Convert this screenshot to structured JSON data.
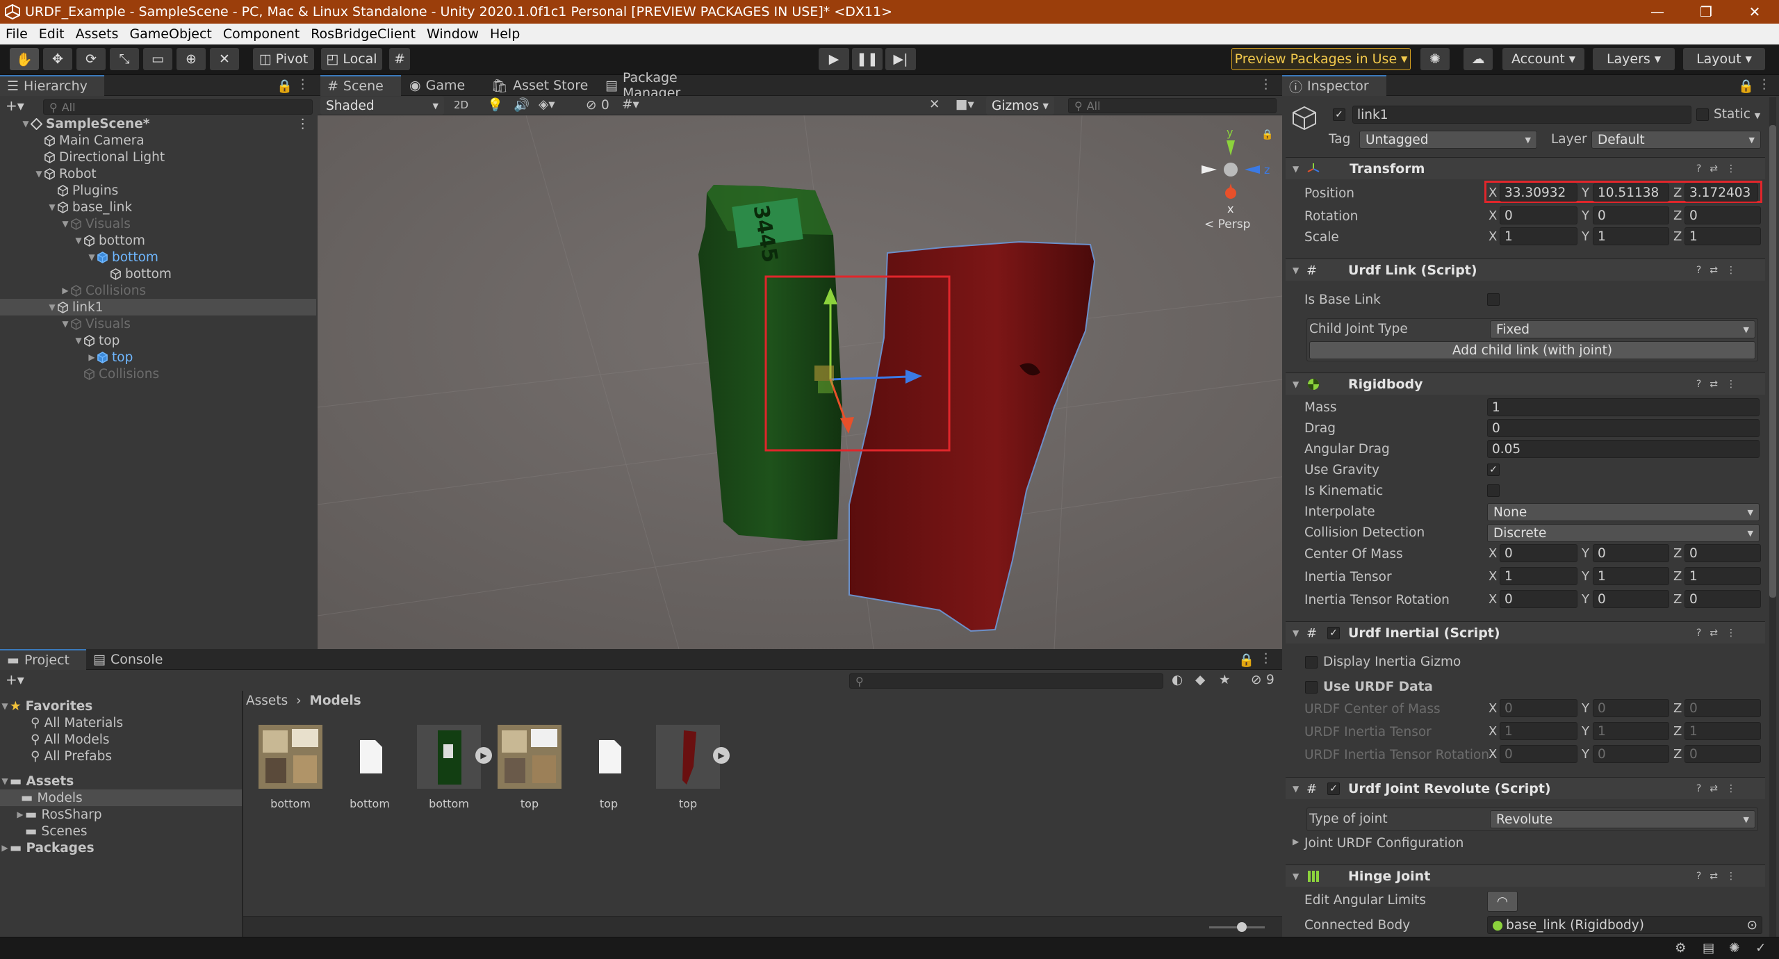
{
  "window": {
    "title": "URDF_Example - SampleScene - PC, Mac & Linux Standalone - Unity 2020.1.0f1c1 Personal [PREVIEW PACKAGES IN USE]* <DX11>",
    "minimize": "—",
    "maximize": "❐",
    "close": "✕"
  },
  "menu": [
    "File",
    "Edit",
    "Assets",
    "GameObject",
    "Component",
    "RosBridgeClient",
    "Window",
    "Help"
  ],
  "toolbar": {
    "pivot": "Pivot",
    "local": "Local",
    "preview_packages": "Preview Packages in Use",
    "account": "Account",
    "layers": "Layers",
    "layout": "Layout"
  },
  "hierarchy": {
    "tab": "Hierarchy",
    "search_placeholder": "All",
    "items": [
      {
        "label": "SampleScene*",
        "depth": 0
      },
      {
        "label": "Main Camera",
        "depth": 1
      },
      {
        "label": "Directional Light",
        "depth": 1
      },
      {
        "label": "Robot",
        "depth": 1
      },
      {
        "label": "Plugins",
        "depth": 2
      },
      {
        "label": "base_link",
        "depth": 2
      },
      {
        "label": "Visuals",
        "depth": 3
      },
      {
        "label": "bottom",
        "depth": 4
      },
      {
        "label": "bottom",
        "depth": 5
      },
      {
        "label": "bottom",
        "depth": 6
      },
      {
        "label": "Collisions",
        "depth": 3
      },
      {
        "label": "link1",
        "depth": 2
      },
      {
        "label": "Visuals",
        "depth": 3
      },
      {
        "label": "top",
        "depth": 4
      },
      {
        "label": "top",
        "depth": 5
      },
      {
        "label": "Collisions",
        "depth": 4
      }
    ]
  },
  "scene": {
    "tabs": [
      "Scene",
      "Game",
      "Asset Store",
      "Package Manager"
    ],
    "shading": "Shaded",
    "mode_2d": "2D",
    "hidden_count": "0",
    "gizmos": "Gizmos",
    "search_placeholder": "All",
    "persp": "< Persp",
    "axis_y": "y",
    "axis_z": "z",
    "axis_x": "x",
    "box_label": "3445"
  },
  "project": {
    "tabs": [
      "Project",
      "Console"
    ],
    "favorites": "Favorites",
    "fav_items": [
      "All Materials",
      "All Models",
      "All Prefabs"
    ],
    "assets": "Assets",
    "asset_items": [
      "Models",
      "RosSharp",
      "Scenes"
    ],
    "packages": "Packages",
    "breadcrumb_root": "Assets",
    "breadcrumb_current": "Models",
    "hidden_count": "9",
    "files": [
      "bottom",
      "bottom",
      "bottom",
      "top",
      "top",
      "top"
    ]
  },
  "inspector": {
    "tab": "Inspector",
    "object_name": "link1",
    "static": "Static",
    "tag_label": "Tag",
    "tag": "Untagged",
    "layer_label": "Layer",
    "layer": "Default",
    "transform": {
      "title": "Transform",
      "position_label": "Position",
      "rotation_label": "Rotation",
      "scale_label": "Scale",
      "position": [
        "33.30932",
        "10.51138",
        "3.172403"
      ],
      "rotation": [
        "0",
        "0",
        "0"
      ],
      "scale": [
        "1",
        "1",
        "1"
      ]
    },
    "urdf_link": {
      "title": "Urdf Link (Script)",
      "is_base_link": "Is Base Link",
      "child_joint_type_label": "Child Joint Type",
      "child_joint_type": "Fixed",
      "add_child": "Add child link (with joint)"
    },
    "rigidbody": {
      "title": "Rigidbody",
      "mass_label": "Mass",
      "mass": "1",
      "drag_label": "Drag",
      "drag": "0",
      "angular_drag_label": "Angular Drag",
      "angular_drag": "0.05",
      "use_gravity": "Use Gravity",
      "is_kinematic": "Is Kinematic",
      "interpolate_label": "Interpolate",
      "interpolate": "None",
      "collision_label": "Collision Detection",
      "collision": "Discrete",
      "com_label": "Center Of Mass",
      "com": [
        "0",
        "0",
        "0"
      ],
      "inertia_label": "Inertia Tensor",
      "inertia": [
        "1",
        "1",
        "1"
      ],
      "inertia_rot_label": "Inertia Tensor Rotation",
      "inertia_rot": [
        "0",
        "0",
        "0"
      ]
    },
    "urdf_inertial": {
      "title": "Urdf Inertial (Script)",
      "display_gizmo": "Display Inertia Gizmo",
      "use_urdf": "Use URDF Data",
      "com_label": "URDF Center of Mass",
      "com": [
        "0",
        "0",
        "0"
      ],
      "inertia_label": "URDF Inertia Tensor",
      "inertia": [
        "1",
        "1",
        "1"
      ],
      "inertia_rot_label": "URDF Inertia Tensor Rotation",
      "inertia_rot": [
        "0",
        "0",
        "0"
      ]
    },
    "urdf_joint": {
      "title": "Urdf Joint Revolute (Script)",
      "type_label": "Type of joint",
      "type": "Revolute",
      "config": "Joint URDF Configuration"
    },
    "hinge": {
      "title": "Hinge Joint",
      "edit_limits": "Edit Angular Limits",
      "connected_label": "Connected Body",
      "connected": "base_link (Rigidbody)"
    }
  },
  "colors": {
    "title_bar": "#9b3e0b",
    "accent": "#3a79bb",
    "highlight": "#e0262b"
  }
}
